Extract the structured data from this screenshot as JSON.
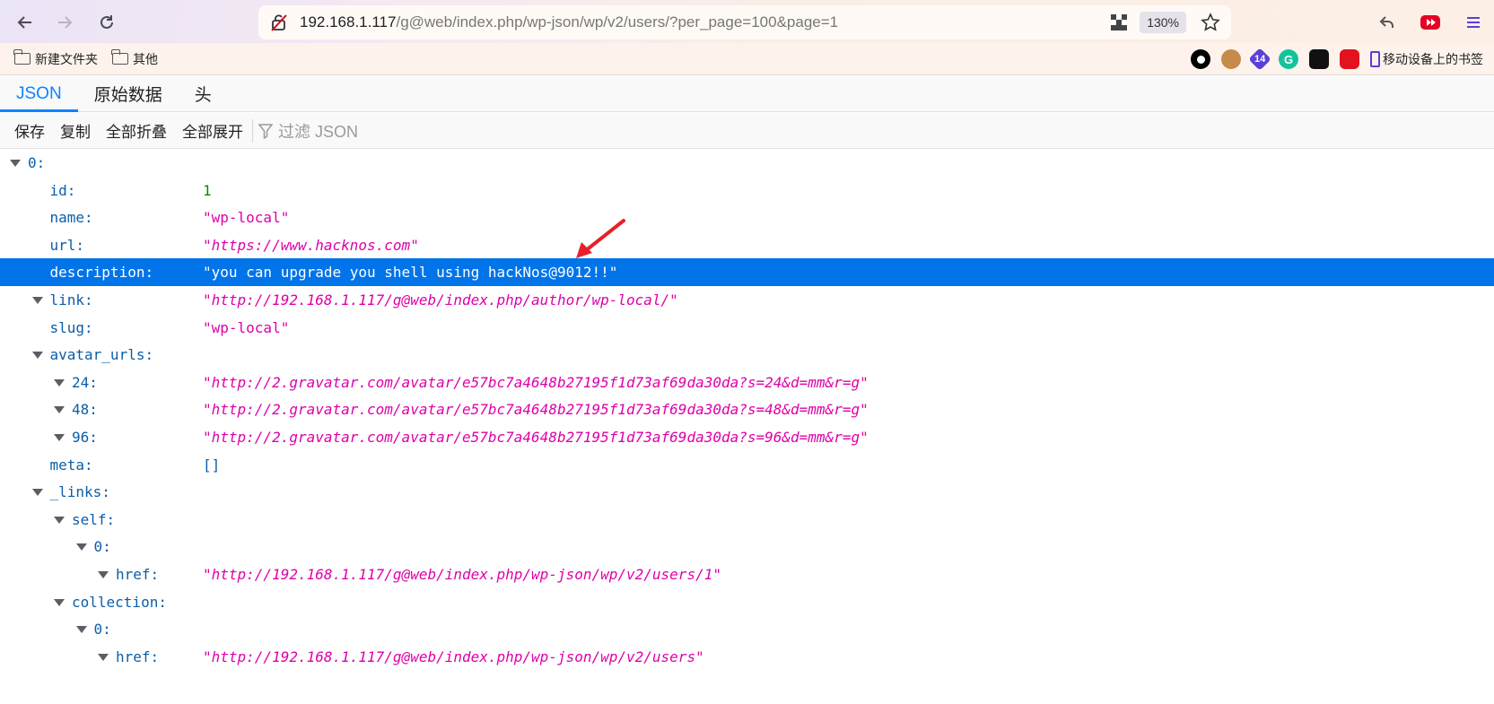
{
  "browser": {
    "url_host": "192.168.1.117",
    "url_path": "/g@web/index.php/wp-json/wp/v2/users/?per_page=100&page=1",
    "zoom": "130%",
    "icons": [
      "back-icon",
      "forward-icon",
      "reload-icon",
      "insecure-lock-icon",
      "qr-code-icon",
      "star-icon",
      "undo-icon",
      "youtube-icon",
      "menu-icon"
    ]
  },
  "bookmarks": {
    "items": [
      "新建文件夹",
      "其他"
    ],
    "extension_badge": "14",
    "mobile": "移动设备上的书签"
  },
  "viewer": {
    "tabs": [
      "JSON",
      "原始数据",
      "头"
    ],
    "actions": [
      "保存",
      "复制",
      "全部折叠",
      "全部展开"
    ],
    "filter_placeholder": "过滤 JSON"
  },
  "tree": [
    {
      "key": "0:",
      "value": "",
      "type": "obj",
      "depth": 0,
      "expandable": true
    },
    {
      "key": "id:",
      "value": "1",
      "type": "num",
      "depth": 1,
      "expandable": false
    },
    {
      "key": "name:",
      "value": "\"wp-local\"",
      "type": "str",
      "depth": 1,
      "expandable": false
    },
    {
      "key": "url:",
      "value": "\"https://www.hacknos.com\"",
      "type": "url",
      "depth": 1,
      "expandable": false
    },
    {
      "key": "description:",
      "value": "\"you can upgrade you shell using hackNos@9012!!\"",
      "type": "str",
      "depth": 1,
      "expandable": false,
      "selected": true
    },
    {
      "key": "link:",
      "value": "\"http://192.168.1.117/g@web/index.php/author/wp-local/\"",
      "type": "url",
      "depth": 1,
      "expandable": true
    },
    {
      "key": "slug:",
      "value": "\"wp-local\"",
      "type": "str",
      "depth": 1,
      "expandable": false
    },
    {
      "key": "avatar_urls:",
      "value": "",
      "type": "obj",
      "depth": 1,
      "expandable": true
    },
    {
      "key": "24:",
      "value": "\"http://2.gravatar.com/avatar/e57bc7a4648b27195f1d73af69da30da?s=24&d=mm&r=g\"",
      "type": "url",
      "depth": 2,
      "expandable": true
    },
    {
      "key": "48:",
      "value": "\"http://2.gravatar.com/avatar/e57bc7a4648b27195f1d73af69da30da?s=48&d=mm&r=g\"",
      "type": "url",
      "depth": 2,
      "expandable": true
    },
    {
      "key": "96:",
      "value": "\"http://2.gravatar.com/avatar/e57bc7a4648b27195f1d73af69da30da?s=96&d=mm&r=g\"",
      "type": "url",
      "depth": 2,
      "expandable": true
    },
    {
      "key": "meta:",
      "value": "[]",
      "type": "arr",
      "depth": 1,
      "expandable": false
    },
    {
      "key": "_links:",
      "value": "",
      "type": "obj",
      "depth": 1,
      "expandable": true
    },
    {
      "key": "self:",
      "value": "",
      "type": "obj",
      "depth": 2,
      "expandable": true
    },
    {
      "key": "0:",
      "value": "",
      "type": "obj",
      "depth": 3,
      "expandable": true
    },
    {
      "key": "href:",
      "value": "\"http://192.168.1.117/g@web/index.php/wp-json/wp/v2/users/1\"",
      "type": "url",
      "depth": 4,
      "expandable": true
    },
    {
      "key": "collection:",
      "value": "",
      "type": "obj",
      "depth": 2,
      "expandable": true
    },
    {
      "key": "0:",
      "value": "",
      "type": "obj",
      "depth": 3,
      "expandable": true
    },
    {
      "key": "href:",
      "value": "\"http://192.168.1.117/g@web/index.php/wp-json/wp/v2/users\"",
      "type": "url",
      "depth": 4,
      "expandable": true
    }
  ],
  "colors": {
    "accent": "#0a84ff",
    "selection": "#0074e8",
    "key": "#0b5ea8",
    "string": "#dd00a9",
    "number": "#058b00",
    "annotation_arrow": "#e8202a"
  }
}
